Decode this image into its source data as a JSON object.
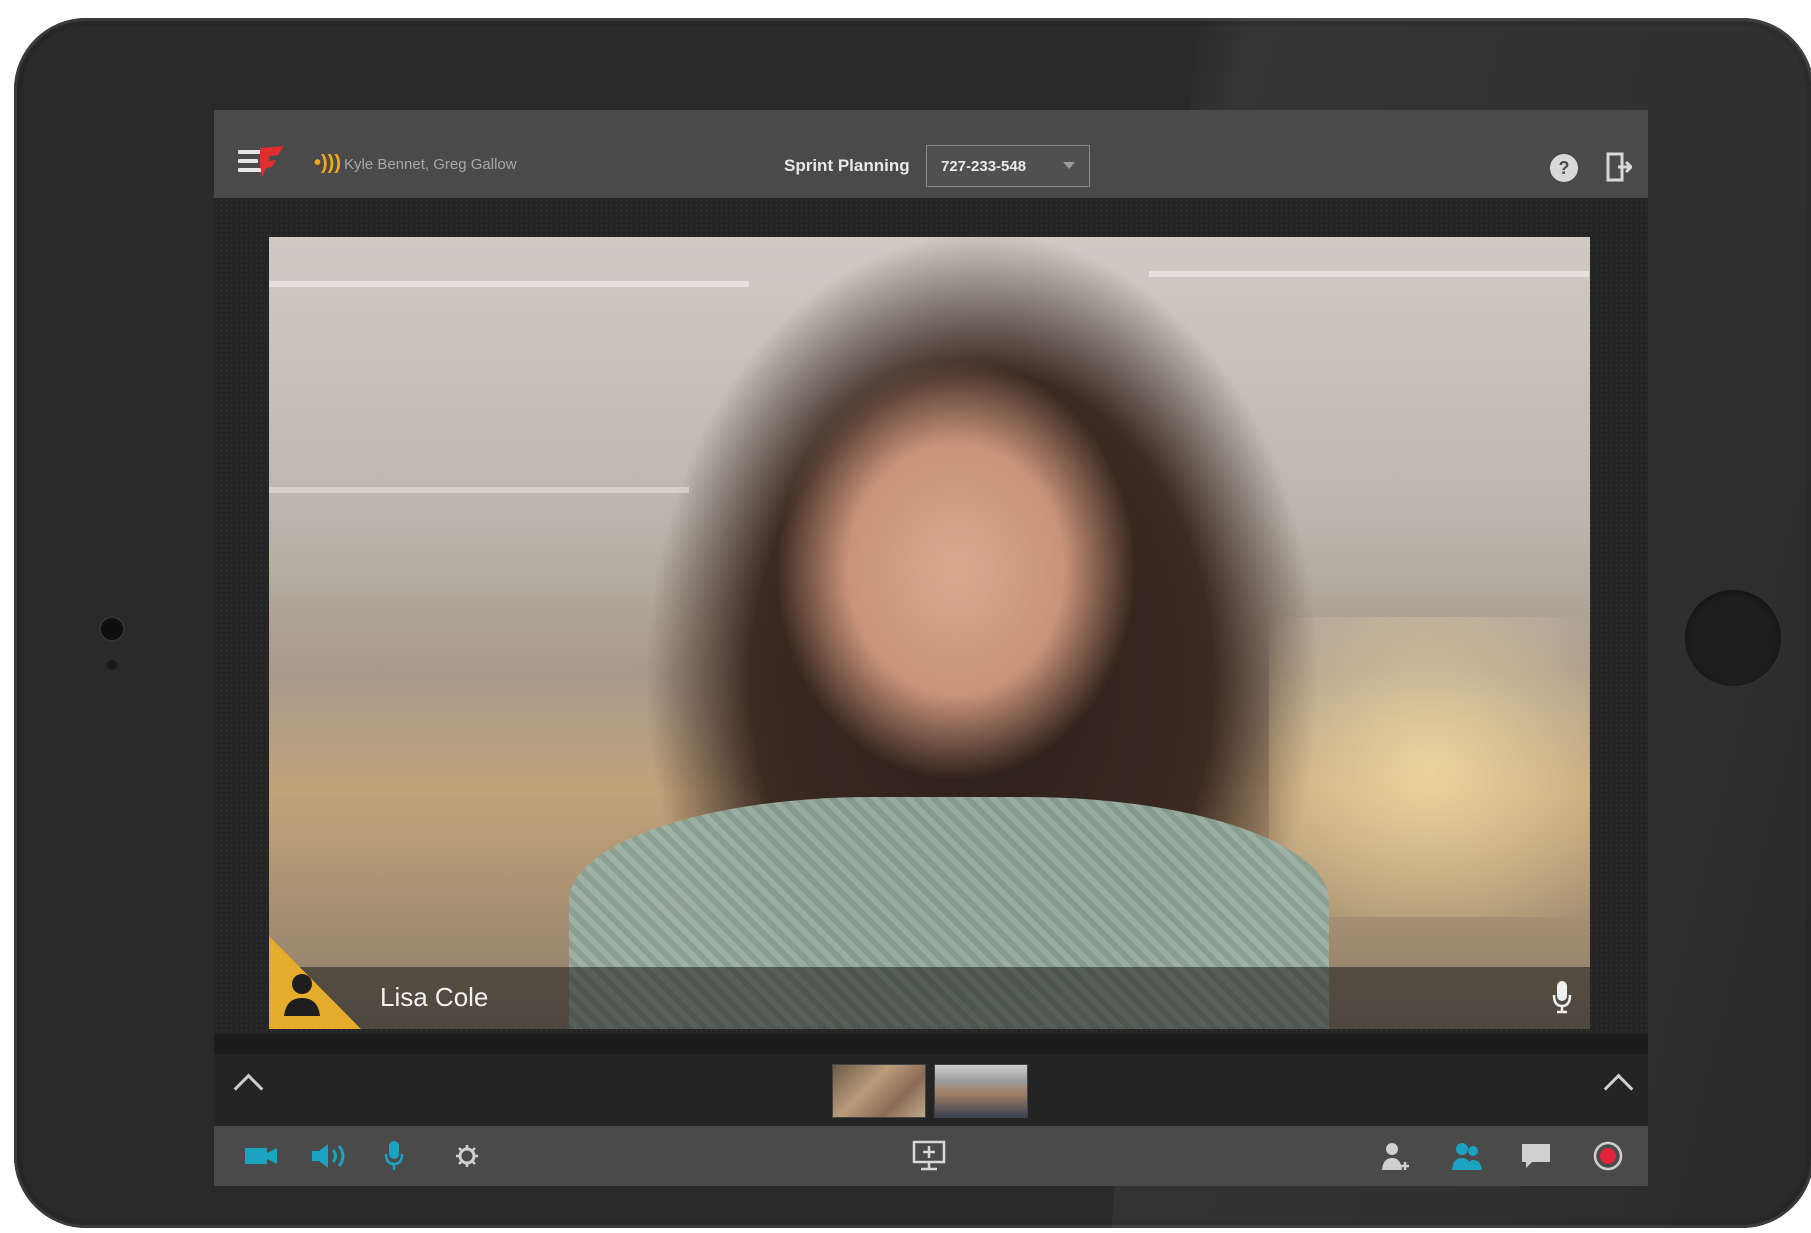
{
  "window": {
    "participants_speaking": "Kyle Bennet, Greg Gallow",
    "meeting_title": "Sprint Planning",
    "meeting_id": "727-233-548"
  },
  "video": {
    "active_speaker_name": "Lisa Cole"
  },
  "icons": {
    "logo": "app-logo-icon",
    "speaking": "speaking-indicator-icon",
    "help": "help-icon",
    "exit": "exit-icon",
    "speaker_avatar": "person-icon",
    "speaker_mic": "microphone-icon",
    "filmstrip_left": "chevron-up-icon",
    "filmstrip_right": "chevron-up-icon",
    "camera": "video-camera-icon",
    "speaker": "speaker-icon",
    "mic": "microphone-icon",
    "settings": "gear-icon",
    "share": "share-screen-icon",
    "add_user": "add-user-icon",
    "participants": "participants-icon",
    "chat": "chat-icon",
    "record": "record-icon"
  },
  "colors": {
    "accent_blue": "#1da3c2",
    "speaker_highlight": "#e5ab2a",
    "record_red": "#e2243a",
    "logo_red": "#e02d2d"
  }
}
